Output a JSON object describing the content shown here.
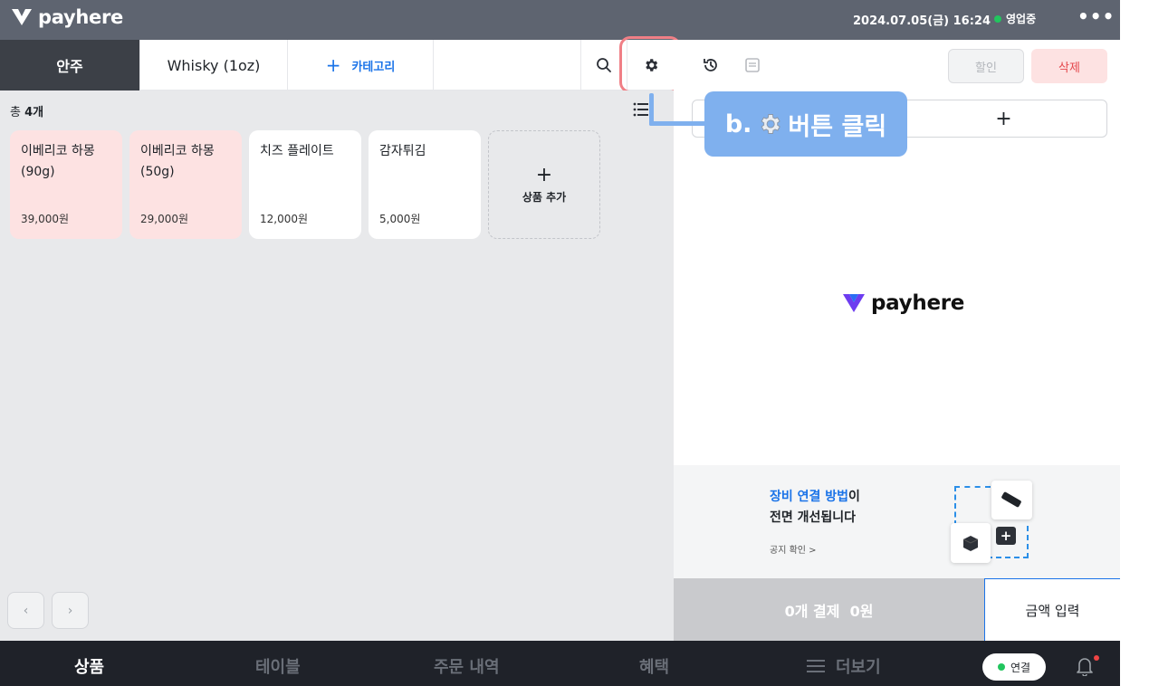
{
  "topbar": {
    "brand": "payhere",
    "datetime": "2024.07.05(금) 16:24",
    "status": "영업중",
    "more": "•••",
    "status_color": "#22c55e"
  },
  "categories": {
    "active": "안주",
    "whisky": "Whisky (1oz)",
    "add_label": "카테고리",
    "add_symbol": "+"
  },
  "products": {
    "total_prefix": "총 ",
    "total_count": "4개",
    "items": [
      {
        "name_line1": "이베리코 하몽",
        "name_line2": "(90g)",
        "price": "39,000원",
        "color": "#fde2e2"
      },
      {
        "name_line1": "이베리코 하몽",
        "name_line2": "(50g)",
        "price": "29,000원",
        "color": "#fde2e2"
      },
      {
        "name_line1": "치즈 플레이트",
        "name_line2": "",
        "price": "12,000원",
        "color": "#ffffff"
      },
      {
        "name_line1": "감자튀김",
        "name_line2": "",
        "price": "5,000원",
        "color": "#ffffff"
      }
    ],
    "add_symbol": "+",
    "add_label": "상품 추가",
    "prev": "‹",
    "next": "›"
  },
  "order": {
    "discount": "할인",
    "delete": "삭제",
    "add_symbol": "+",
    "brand": "payhere",
    "banner": {
      "title_blue": "장비 연결 방법",
      "title_rest": "이",
      "title_line2": "전면 개선됩니다",
      "link": "공지 확인 >"
    },
    "pay": "0개 결제  0원",
    "amount_input": "금액 입력"
  },
  "callout": {
    "prefix": "b.",
    "text": "버튼 클릭"
  },
  "nav": {
    "items": [
      "상품",
      "테이블",
      "주문 내역",
      "혜택",
      "더보기"
    ],
    "connect": "연결"
  },
  "colors": {
    "accent": "#1a73e8",
    "callout": "#7fb0ee",
    "highlight": "#f07f86",
    "topbar": "#5e6470",
    "nav": "#1f2229"
  }
}
